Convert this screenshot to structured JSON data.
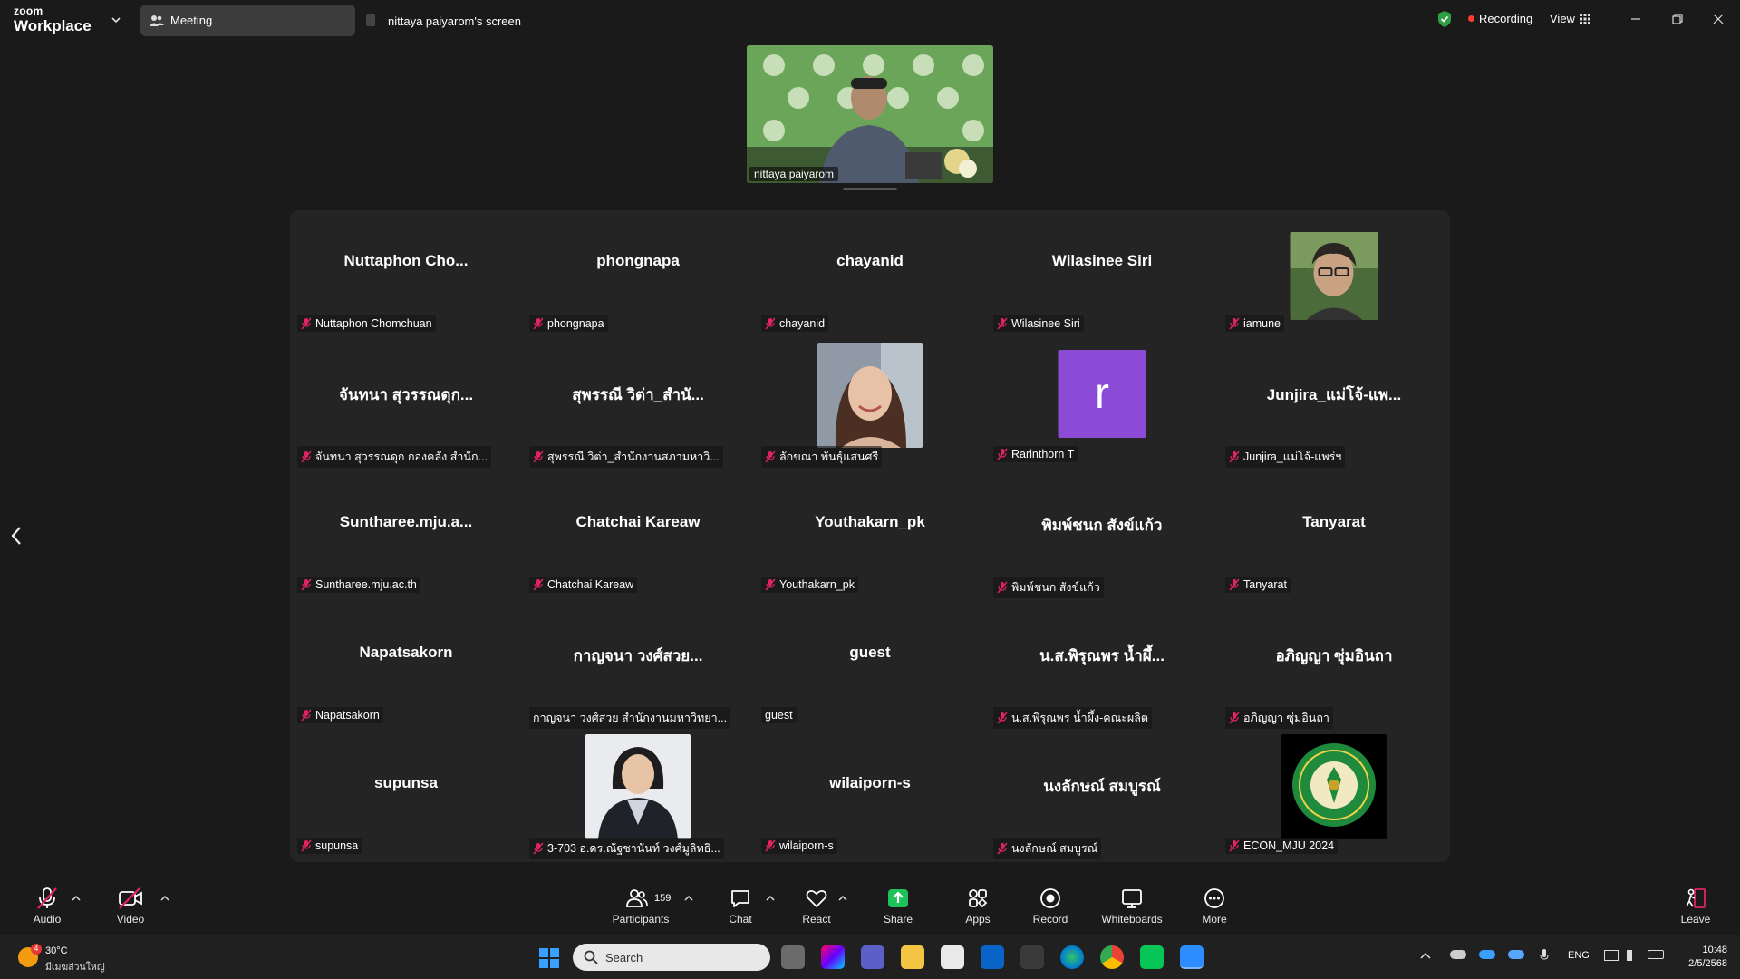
{
  "titlebar": {
    "brand_top": "zoom",
    "brand_bottom": "Workplace",
    "tab_meeting": "Meeting",
    "tab_screen": "nittaya paiyarom's screen",
    "recording": "Recording",
    "view": "View"
  },
  "speaker": {
    "name": "nittaya paiyarom"
  },
  "participants": [
    {
      "display": "Nuttaphon  Cho...",
      "label": "Nuttaphon Chomchuan"
    },
    {
      "display": "phongnapa",
      "label": "phongnapa"
    },
    {
      "display": "chayanid",
      "label": "chayanid"
    },
    {
      "display": "Wilasinee Siri",
      "label": "Wilasinee Siri"
    },
    {
      "display": "",
      "label": "iamune"
    },
    {
      "display": "จันทนา สุวรรณดุก...",
      "label": "จันทนา สุวรรณดุก กองคลัง สำนัก..."
    },
    {
      "display": "สุพรรณี วิต่า_สำนั...",
      "label": "สุพรรณี วิต่า_สำนักงานสภามหาวิ..."
    },
    {
      "display": "",
      "label": "ลักขณา พันธุ์แสนศรี"
    },
    {
      "display": "",
      "label": "Rarinthorn T"
    },
    {
      "display": "Junjira_แม่โจ้-แพ...",
      "label": "Junjira_แม่โจ้-แพร่ฯ"
    },
    {
      "display": "Suntharee.mju.a...",
      "label": "Suntharee.mju.ac.th"
    },
    {
      "display": "Chatchai Kareaw",
      "label": "Chatchai Kareaw"
    },
    {
      "display": "Youthakarn_pk",
      "label": "Youthakarn_pk"
    },
    {
      "display": "พิมพ์ชนก สังข์แก้ว",
      "label": "พิมพ์ชนก สังข์แก้ว"
    },
    {
      "display": "Tanyarat",
      "label": "Tanyarat"
    },
    {
      "display": "Napatsakorn",
      "label": "Napatsakorn"
    },
    {
      "display": "กาญจนา วงศ์สวย...",
      "label": "กาญจนา วงศ์สวย สำนักงานมหาวิทยา..."
    },
    {
      "display": "guest",
      "label": "guest"
    },
    {
      "display": "น.ส.พิรุณพร  น้ำผึ้...",
      "label": "น.ส.พิรุณพร  น้ำผึ้ง-คณะผลิต"
    },
    {
      "display": "อภิญญา ซุ่มอินถา",
      "label": "อภิญญา ซุ่มอินถา"
    },
    {
      "display": "supunsa",
      "label": "supunsa"
    },
    {
      "display": "",
      "label": "3-703 อ.ดร.ณัฐชานันท์ วงศ์มูลิทธิ..."
    },
    {
      "display": "wilaiporn-s",
      "label": "wilaiporn-s"
    },
    {
      "display": "นงลักษณ์ สมบูรณ์",
      "label": "นงลักษณ์ สมบูรณ์"
    },
    {
      "display": "",
      "label": "ECON_MJU 2024"
    }
  ],
  "avatar_letter": "r",
  "toolbar": {
    "audio": "Audio",
    "video": "Video",
    "participants": "Participants",
    "participant_count": "159",
    "chat": "Chat",
    "react": "React",
    "share": "Share",
    "apps": "Apps",
    "record": "Record",
    "whiteboards": "Whiteboards",
    "more": "More",
    "leave": "Leave"
  },
  "taskbar": {
    "weather_badge": "4",
    "temperature": "30°C",
    "weather_text": "มีเมฆส่วนใหญ่",
    "search": "Search",
    "lang": "ENG",
    "time": "10:48",
    "date": "2/5/2568"
  },
  "colors": {
    "accent_green": "#2ea043",
    "share_green": "#1ec25a",
    "mute_red": "#e0245e",
    "avatar_purple": "#8b4bd6",
    "record_red": "#ff3b30"
  }
}
